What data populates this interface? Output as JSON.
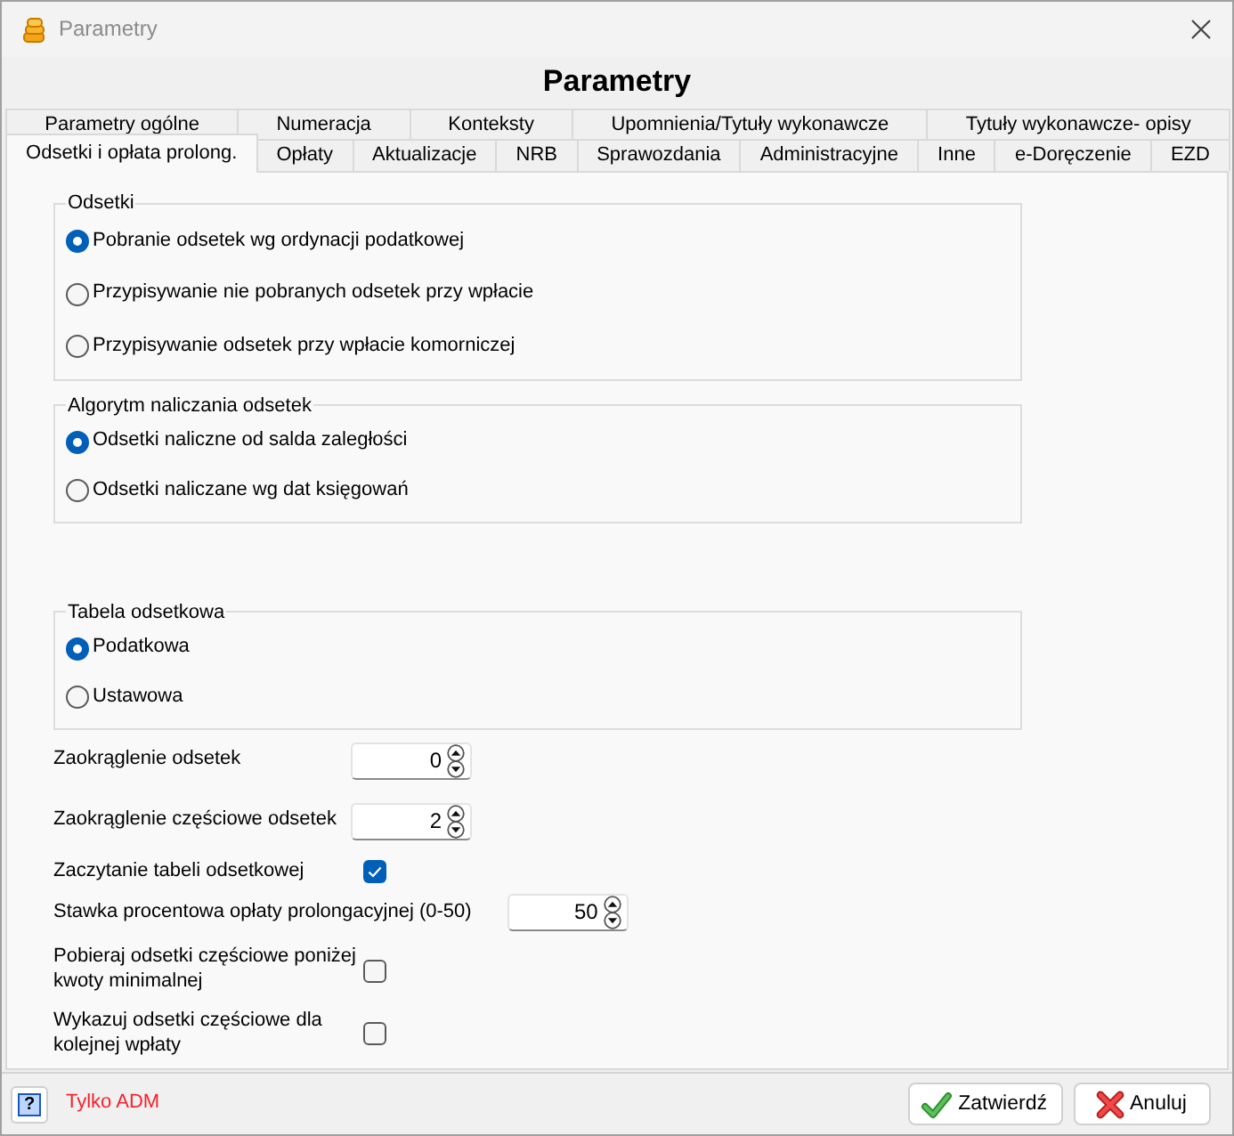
{
  "window": {
    "title": "Parametry"
  },
  "heading": "Parametry",
  "tab_rows": [
    {
      "tabs": [
        {
          "label": "Parametry ogólne",
          "selected": false
        },
        {
          "label": "Numeracja",
          "selected": false
        },
        {
          "label": "Konteksty",
          "selected": false
        },
        {
          "label": "Upomnienia/Tytuły wykonawcze",
          "selected": false
        },
        {
          "label": "Tytuły wykonawcze- opisy",
          "selected": false
        }
      ]
    },
    {
      "tabs": [
        {
          "label": "Odsetki i opłata prolong.",
          "selected": true
        },
        {
          "label": "Opłaty",
          "selected": false
        },
        {
          "label": "Aktualizacje",
          "selected": false
        },
        {
          "label": "NRB",
          "selected": false
        },
        {
          "label": "Sprawozdania",
          "selected": false
        },
        {
          "label": "Administracyjne",
          "selected": false
        },
        {
          "label": "Inne",
          "selected": false
        },
        {
          "label": "e-Doręczenie",
          "selected": false
        },
        {
          "label": "EZD",
          "selected": false
        }
      ]
    }
  ],
  "groups": [
    {
      "title": "Odsetki",
      "options": [
        {
          "label": "Pobranie odsetek wg ordynacji podatkowej",
          "selected": true
        },
        {
          "label": "Przypisywanie nie pobranych odsetek przy wpłacie",
          "selected": false
        },
        {
          "label": "Przypisywanie odsetek przy wpłacie komorniczej",
          "selected": false
        }
      ]
    },
    {
      "title": "Algorytm naliczania odsetek",
      "options": [
        {
          "label": "Odsetki naliczne od salda zaległości",
          "selected": true
        },
        {
          "label": "Odsetki naliczane wg dat księgowań",
          "selected": false
        }
      ]
    },
    {
      "title": "Tabela odsetkowa",
      "options": [
        {
          "label": "Podatkowa",
          "selected": true
        },
        {
          "label": "Ustawowa",
          "selected": false
        }
      ]
    }
  ],
  "fields": [
    {
      "kind": "spin",
      "label": "Zaokrąglenie odsetek",
      "value": "0"
    },
    {
      "kind": "spin",
      "label": "Zaokrąglenie częściowe odsetek",
      "value": "2"
    },
    {
      "kind": "checkbox",
      "label": "Zaczytanie tabeli odsetkowej",
      "checked": true
    },
    {
      "kind": "spin",
      "label": "Stawka procentowa opłaty prolongacyjnej (0-50)",
      "value": "50"
    },
    {
      "kind": "checkbox",
      "label": "Pobieraj odsetki częściowe poniżej kwoty minimalnej",
      "checked": false
    },
    {
      "kind": "checkbox",
      "label": "Wykazuj odsetki częściowe dla kolejnej wpłaty",
      "checked": false
    }
  ],
  "footer": {
    "help_button": "?",
    "note": "Tylko ADM",
    "buttons": [
      {
        "kind": "confirm",
        "label": "Zatwierdź"
      },
      {
        "kind": "cancel",
        "label": "Anuluj"
      }
    ]
  }
}
